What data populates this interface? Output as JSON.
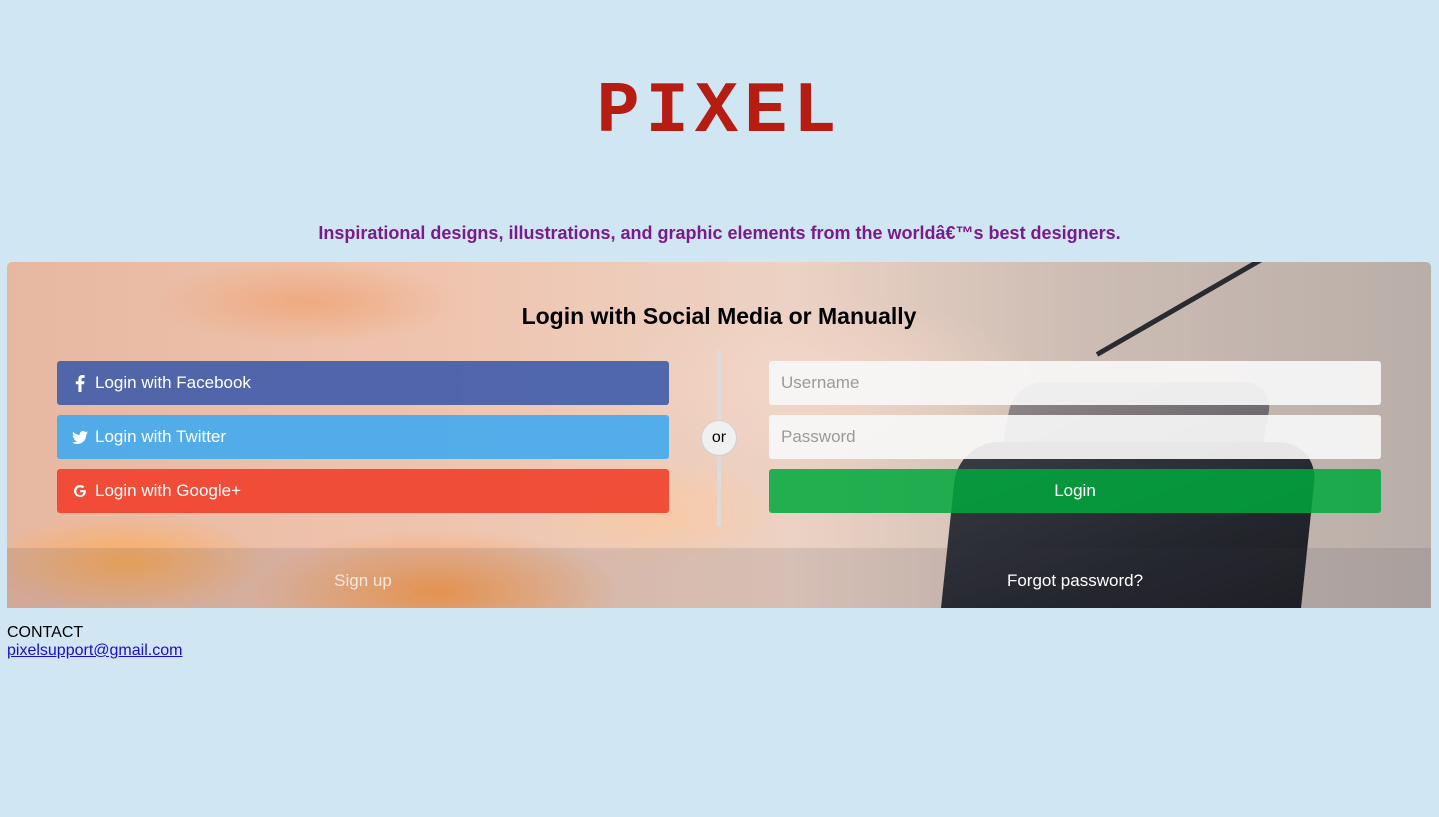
{
  "header": {
    "logo_text": "PIXEL",
    "tagline": "Inspirational designs, illustrations, and graphic elements from the worldâ€™s best designers."
  },
  "login_panel": {
    "title": "Login with Social Media or Manually",
    "social_buttons": {
      "facebook": {
        "label": "Login with Facebook",
        "icon": "facebook-icon",
        "color": "#3b59aa"
      },
      "twitter": {
        "label": "Login with Twitter",
        "icon": "twitter-icon",
        "color": "#40aaf0"
      },
      "google": {
        "label": "Login with Google+",
        "icon": "google-icon",
        "color": "#f03c28"
      }
    },
    "divider_label": "or",
    "username": {
      "placeholder": "Username",
      "value": ""
    },
    "password": {
      "placeholder": "Password",
      "value": ""
    },
    "login_label": "Login",
    "login_color": "#00a83c",
    "signup_label": "Sign up",
    "forgot_label": "Forgot password?"
  },
  "contact": {
    "heading": "CONTACT",
    "email": "pixelsupport@gmail.com"
  },
  "colors": {
    "background": "#d0e6f3",
    "logo": "#b71c12",
    "tagline": "#7b1a8a",
    "link": "#1a0dcc"
  }
}
